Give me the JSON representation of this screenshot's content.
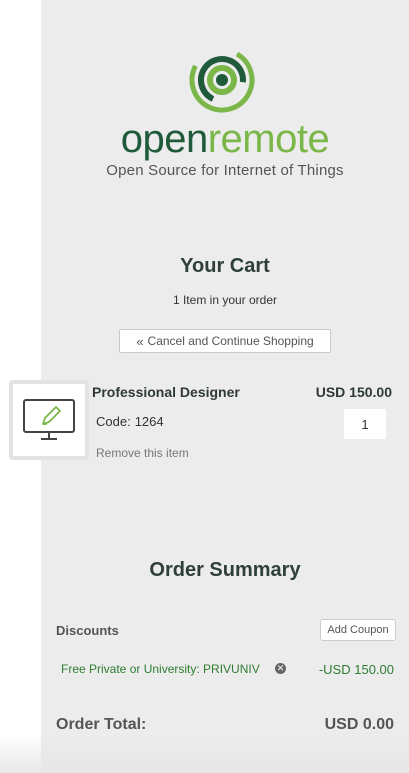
{
  "brand": {
    "name_part1": "open",
    "name_part2": "remote",
    "tagline": "Open Source for Internet of Things",
    "colors": {
      "dark_green": "#1f5b3a",
      "light_green": "#7ab648"
    }
  },
  "cart": {
    "title": "Your Cart",
    "item_count_text": "1 Item in your order",
    "cancel_button_label": "Cancel and Continue Shopping",
    "cancel_button_icon": "double-chevron-left-icon"
  },
  "item": {
    "name": "Professional Designer",
    "price": "USD 150.00",
    "code_label": "Code:",
    "code_value": "1264",
    "quantity": "1",
    "remove_label": "Remove this item",
    "icon": "monitor-pencil-icon"
  },
  "summary": {
    "title": "Order Summary",
    "discounts_label": "Discounts",
    "add_coupon_label": "Add Coupon",
    "discount_name": "Free Private or University: PRIVUNIV",
    "discount_amount": "-USD 150.00",
    "total_label": "Order Total:",
    "total_amount": "USD 0.00"
  }
}
